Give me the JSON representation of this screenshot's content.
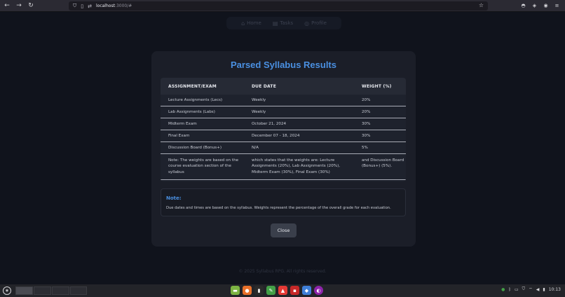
{
  "browser": {
    "url_host": "localhost",
    "url_port": ":3000/#"
  },
  "nav": {
    "items": [
      {
        "label": "Home",
        "icon": "home-icon"
      },
      {
        "label": "Tasks",
        "icon": "tasks-icon"
      },
      {
        "label": "Profile",
        "icon": "profile-icon"
      }
    ]
  },
  "modal": {
    "title": "Parsed Syllabus Results",
    "table": {
      "headers": [
        "ASSIGNMENT/EXAM",
        "DUE DATE",
        "WEIGHT (%)"
      ],
      "rows": [
        [
          "Lecture Assignments (Lecs)",
          "Weekly",
          "20%"
        ],
        [
          "Lab Assignments (Labs)",
          "Weekly",
          "20%"
        ],
        [
          "Midterm Exam",
          "October 21, 2024",
          "30%"
        ],
        [
          "Final Exam",
          "December 07 - 18, 2024",
          "30%"
        ],
        [
          "Discussion Board (Bonus+)",
          "N/A",
          "5%"
        ],
        [
          "Note: The weights are based on the course evaluation section of the syllabus",
          "which states that the weights are: Lecture Assignments (20%), Lab Assignments (20%), Midterm Exam (30%), Final Exam (30%)",
          "and Discussion Board (Bonus+) (5%)."
        ]
      ]
    },
    "note": {
      "title": "Note:",
      "text": "Due dates and times are based on the syllabus. Weights represent the percentage of the overall grade for each evaluation."
    },
    "close_label": "Close"
  },
  "footer": {
    "text": "© 2025 Syllabus RPG. All rights reserved."
  },
  "taskbar": {
    "clock": "10:13"
  },
  "colors": {
    "accent": "#4a90e2",
    "page_bg": "#10131c",
    "modal_bg": "#1b1e28"
  }
}
